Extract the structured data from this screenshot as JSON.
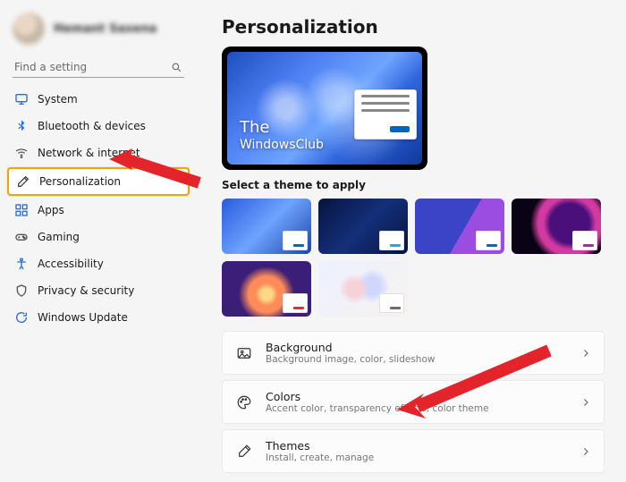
{
  "user": {
    "name": "Hemant Saxena"
  },
  "search": {
    "placeholder": "Find a setting"
  },
  "nav": {
    "items": [
      {
        "label": "System"
      },
      {
        "label": "Bluetooth & devices"
      },
      {
        "label": "Network & internet"
      },
      {
        "label": "Personalization"
      },
      {
        "label": "Apps"
      },
      {
        "label": "Gaming"
      },
      {
        "label": "Accessibility"
      },
      {
        "label": "Privacy & security"
      },
      {
        "label": "Windows Update"
      }
    ]
  },
  "page": {
    "title": "Personalization",
    "preview_watermark_top": "The",
    "preview_watermark_bottom": "WindowsClub",
    "themes_label": "Select a theme to apply"
  },
  "settings": [
    {
      "title": "Background",
      "sub": "Background image, color, slideshow"
    },
    {
      "title": "Colors",
      "sub": "Accent color, transparency effects, color theme"
    },
    {
      "title": "Themes",
      "sub": "Install, create, manage"
    }
  ]
}
